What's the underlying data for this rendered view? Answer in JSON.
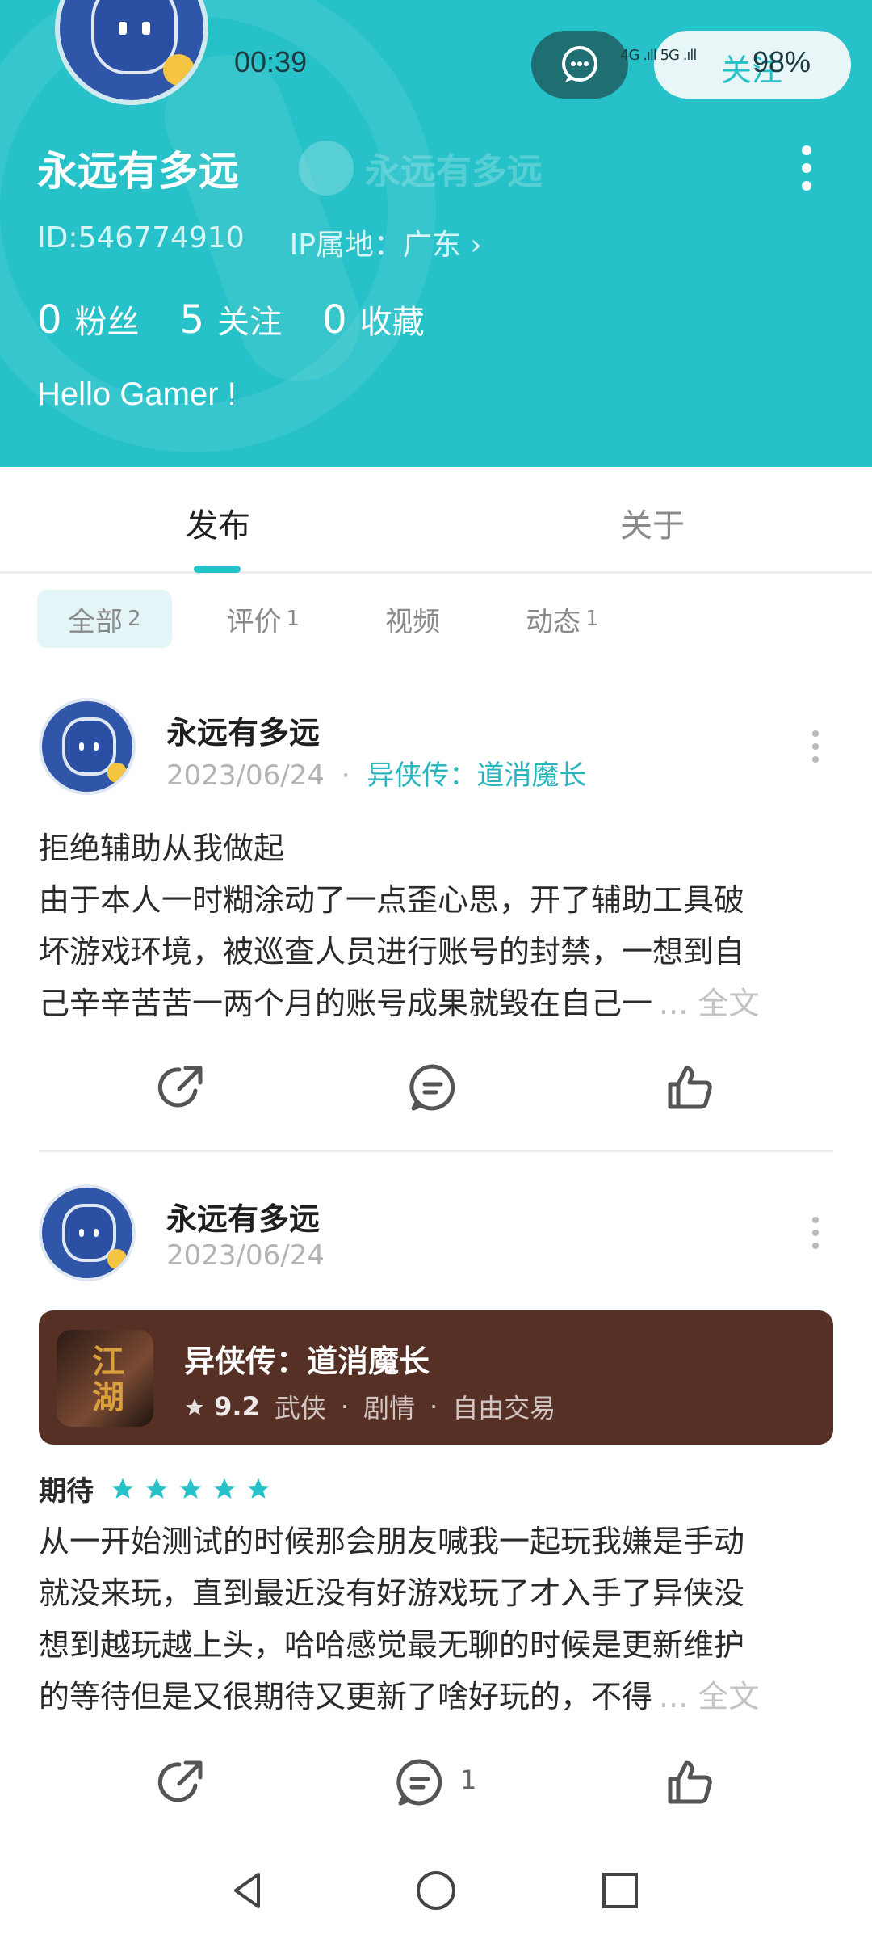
{
  "status_bar": {
    "time": "00:39",
    "signal": "4G .ıll 5G .ıll",
    "follow_overlay": "关注",
    "battery": "98%"
  },
  "profile": {
    "name": "永远有多远",
    "ghost_name": "永远有多远",
    "id": "ID:546774910",
    "ip_location": "IP属地：广东 ›",
    "stats": [
      {
        "num": "0",
        "label": "粉丝"
      },
      {
        "num": "5",
        "label": "关注"
      },
      {
        "num": "0",
        "label": "收藏"
      }
    ],
    "bio": "Hello Gamer !"
  },
  "tabs": [
    {
      "label": "发布",
      "active": true
    },
    {
      "label": "关于",
      "active": false
    }
  ],
  "filters": [
    {
      "label": "全部",
      "count": "2",
      "active": true
    },
    {
      "label": "评价",
      "count": "1",
      "active": false
    },
    {
      "label": "视频",
      "count": "",
      "active": false
    },
    {
      "label": "动态",
      "count": "1",
      "active": false
    }
  ],
  "posts": [
    {
      "author": "永远有多远",
      "date": "2023/06/24",
      "separator": "·",
      "game_link": "异侠传：道消魔长",
      "lines": [
        "拒绝辅助从我做起",
        "由于本人一时糊涂动了一点歪心思，开了辅助工具破",
        "坏游戏环境，被巡查人员进行账号的封禁，一想到自",
        "己辛辛苦苦一两个月的账号成果就毁在自己一"
      ],
      "more": "... 全文",
      "comment_count": ""
    },
    {
      "author": "永远有多远",
      "date": "2023/06/24",
      "game_card": {
        "title": "异侠传：道消魔长",
        "icon_text": "江湖",
        "score": "9.2",
        "tags": [
          "武侠",
          "·",
          "剧情",
          "·",
          "自由交易"
        ]
      },
      "rating_label": "期待",
      "rating_stars": 5,
      "lines": [
        "从一开始测试的时候那会朋友喊我一起玩我嫌是手动",
        "就没来玩，直到最近没有好游戏玩了才入手了异侠没",
        "想到越玩越上头，哈哈感觉最无聊的时候是更新维护",
        "的等待但是又很期待又更新了啥好玩的，不得"
      ],
      "more": "... 全文",
      "comment_count": "1"
    }
  ],
  "colors": {
    "accent": "#27c2c9",
    "game_card_bg": "#562f25",
    "star": "#27c2c9"
  }
}
